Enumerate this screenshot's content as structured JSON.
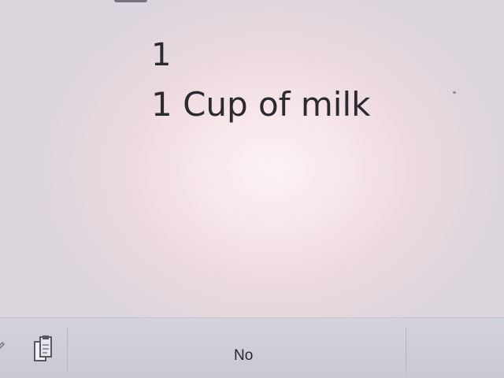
{
  "document": {
    "lines": [
      "1",
      "1 Cup of milk"
    ]
  },
  "toolbar": {
    "no_label": "No",
    "left_icon": "pen-icon",
    "clipboard_icon": "clipboard-icon"
  },
  "colors": {
    "text": "#2a2a30",
    "toolbar": "#d0cdd7"
  }
}
